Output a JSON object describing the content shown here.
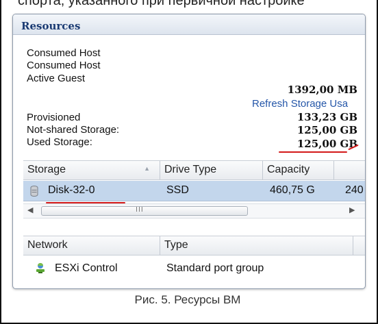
{
  "top_fragment": "спорта, указанного при первичной настройке",
  "panel": {
    "title": "Resources",
    "rows": {
      "consumed_host_1": "Consumed Host",
      "consumed_host_2": "Consumed Host",
      "active_guest": "Active Guest",
      "active_guest_value": "1392,00 MB",
      "refresh_link": "Refresh Storage Usa",
      "provisioned": "Provisioned",
      "provisioned_value": "133,23 GB",
      "not_shared": "Not-shared Storage:",
      "not_shared_value": "125,00 GB",
      "used_storage": "Used Storage:",
      "used_storage_value": "125,00 GB"
    },
    "storage_table": {
      "columns": [
        "Storage",
        "Drive Type",
        "Capacity"
      ],
      "row": {
        "storage": "Disk-32-0",
        "drive_type": "SSD",
        "capacity": "460,75 G",
        "extra": "240"
      },
      "scroll_grip": "III"
    },
    "network_table": {
      "columns": [
        "Network",
        "Type"
      ],
      "row": {
        "network": "ESXi Control",
        "type": "Standard port group"
      }
    }
  },
  "caption": "Рис. 5. Ресурсы ВМ",
  "colors": {
    "accent": "#1b3b73",
    "link": "#2456a8",
    "selection": "#c3d6ec",
    "underline": "#d31818"
  }
}
